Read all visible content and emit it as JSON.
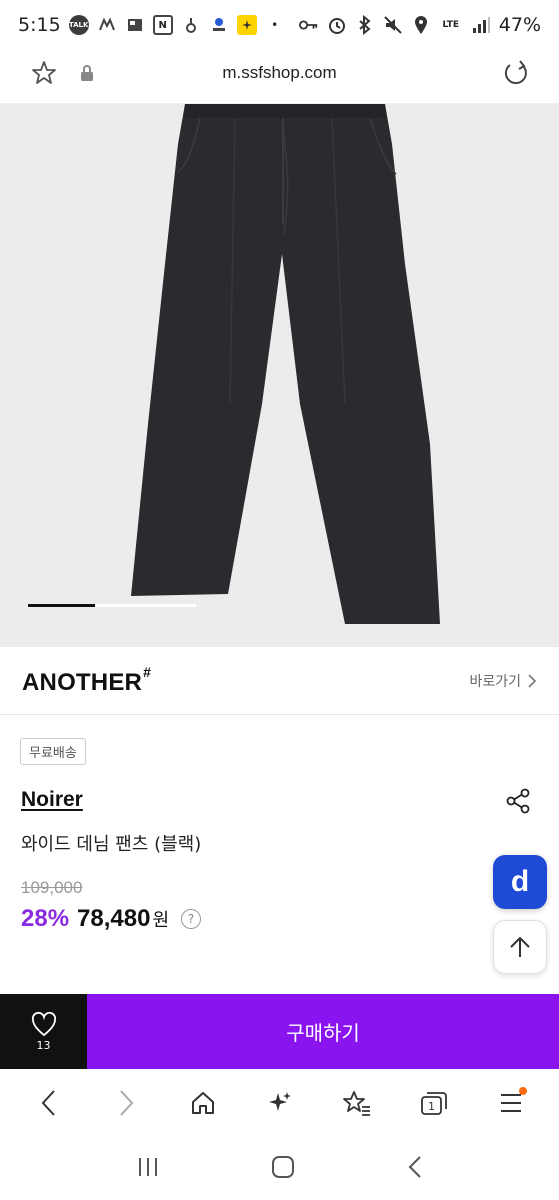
{
  "status_bar": {
    "time": "5:15",
    "battery": "47%",
    "network": "LTE"
  },
  "browser": {
    "url": "m.ssfshop.com"
  },
  "brand": {
    "name": "ANOTHER",
    "mark": "#",
    "link_label": "바로가기"
  },
  "product": {
    "badge": "무료배송",
    "brand": "Noirer",
    "name": "와이드 데님 팬츠 (블랙)",
    "original_price": "109,000",
    "discount": "28%",
    "sale_price": "78,480",
    "currency": "원",
    "image_progress": 0.4
  },
  "floating": {
    "d_label": "d"
  },
  "purchase_bar": {
    "wish_count": "13",
    "buy_label": "구매하기"
  },
  "colors": {
    "accent_purple": "#8a14f0",
    "discount_purple": "#8a2be2",
    "fab_blue": "#1f4ad6",
    "menu_notice_dot": "#ff6a13"
  }
}
